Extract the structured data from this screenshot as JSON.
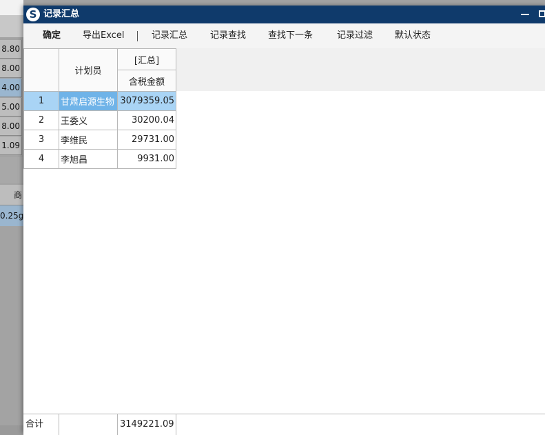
{
  "background": {
    "column_values": [
      "8.80",
      "8.00",
      "4.00",
      "5.00",
      "8.00",
      "1.09"
    ],
    "header2_label": "商",
    "row2_value": "0.25g"
  },
  "dialog": {
    "title": "记录汇总",
    "toolbar": {
      "confirm": "确定",
      "export_excel": "导出Excel",
      "summary": "记录汇总",
      "find": "记录查找",
      "find_next": "查找下一条",
      "filter": "记录过滤",
      "default_state": "默认状态"
    },
    "table": {
      "col_planner": "计划员",
      "group_header": "[汇总]",
      "col_amount": "含税金额",
      "rows": [
        {
          "no": "1",
          "planner": "甘肃启源生物",
          "amount": "3079359.05"
        },
        {
          "no": "2",
          "planner": "王委义",
          "amount": "30200.04"
        },
        {
          "no": "3",
          "planner": "李维民",
          "amount": "29731.00"
        },
        {
          "no": "4",
          "planner": "李旭昌",
          "amount": "9931.00"
        }
      ]
    },
    "footer": {
      "label": "合计",
      "total": "3149221.09"
    }
  },
  "colors": {
    "titlebar": "#0f3a6b",
    "selected_row": "#a9d4f5",
    "selected_cell": "#6fb3e8"
  }
}
